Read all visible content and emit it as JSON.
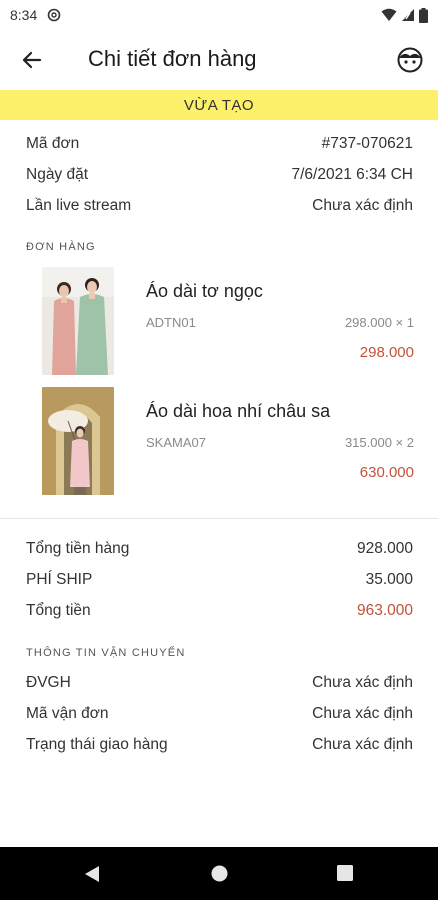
{
  "status_bar": {
    "time": "8:34"
  },
  "header": {
    "title": "Chi tiết đơn hàng"
  },
  "banner": {
    "status": "VỪA TẠO"
  },
  "order_info": [
    {
      "label": "Mã đơn",
      "value": "#737-070621"
    },
    {
      "label": "Ngày đặt",
      "value": "7/6/2021 6:34 CH"
    },
    {
      "label": "Lần live stream",
      "value": "Chưa xác định"
    }
  ],
  "products_section": {
    "label": "ĐƠN HÀNG",
    "items": [
      {
        "name": "Áo dài tơ ngọc",
        "sku": "ADTN01",
        "unit": "298.000 × 1",
        "total": "298.000"
      },
      {
        "name": "Áo dài hoa nhí châu sa",
        "sku": "SKAMA07",
        "unit": "315.000 × 2",
        "total": "630.000"
      }
    ]
  },
  "summary": [
    {
      "label": "Tổng tiền hàng",
      "value": "928.000"
    },
    {
      "label": "PHÍ SHIP",
      "value": "35.000"
    },
    {
      "label": "Tổng tiền",
      "value": "963.000"
    }
  ],
  "shipping": {
    "label": "THÔNG TIN VẬN CHUYỂN",
    "rows": [
      {
        "label": "ĐVGH",
        "value": "Chưa xác định"
      },
      {
        "label": "Mã vận đơn",
        "value": "Chưa xác định"
      },
      {
        "label": "Trạng thái giao hàng",
        "value": "Chưa xác định"
      }
    ]
  },
  "colors": {
    "banner": "#fdf06a",
    "accent": "#c0533a",
    "muted": "#8a8a8a"
  }
}
